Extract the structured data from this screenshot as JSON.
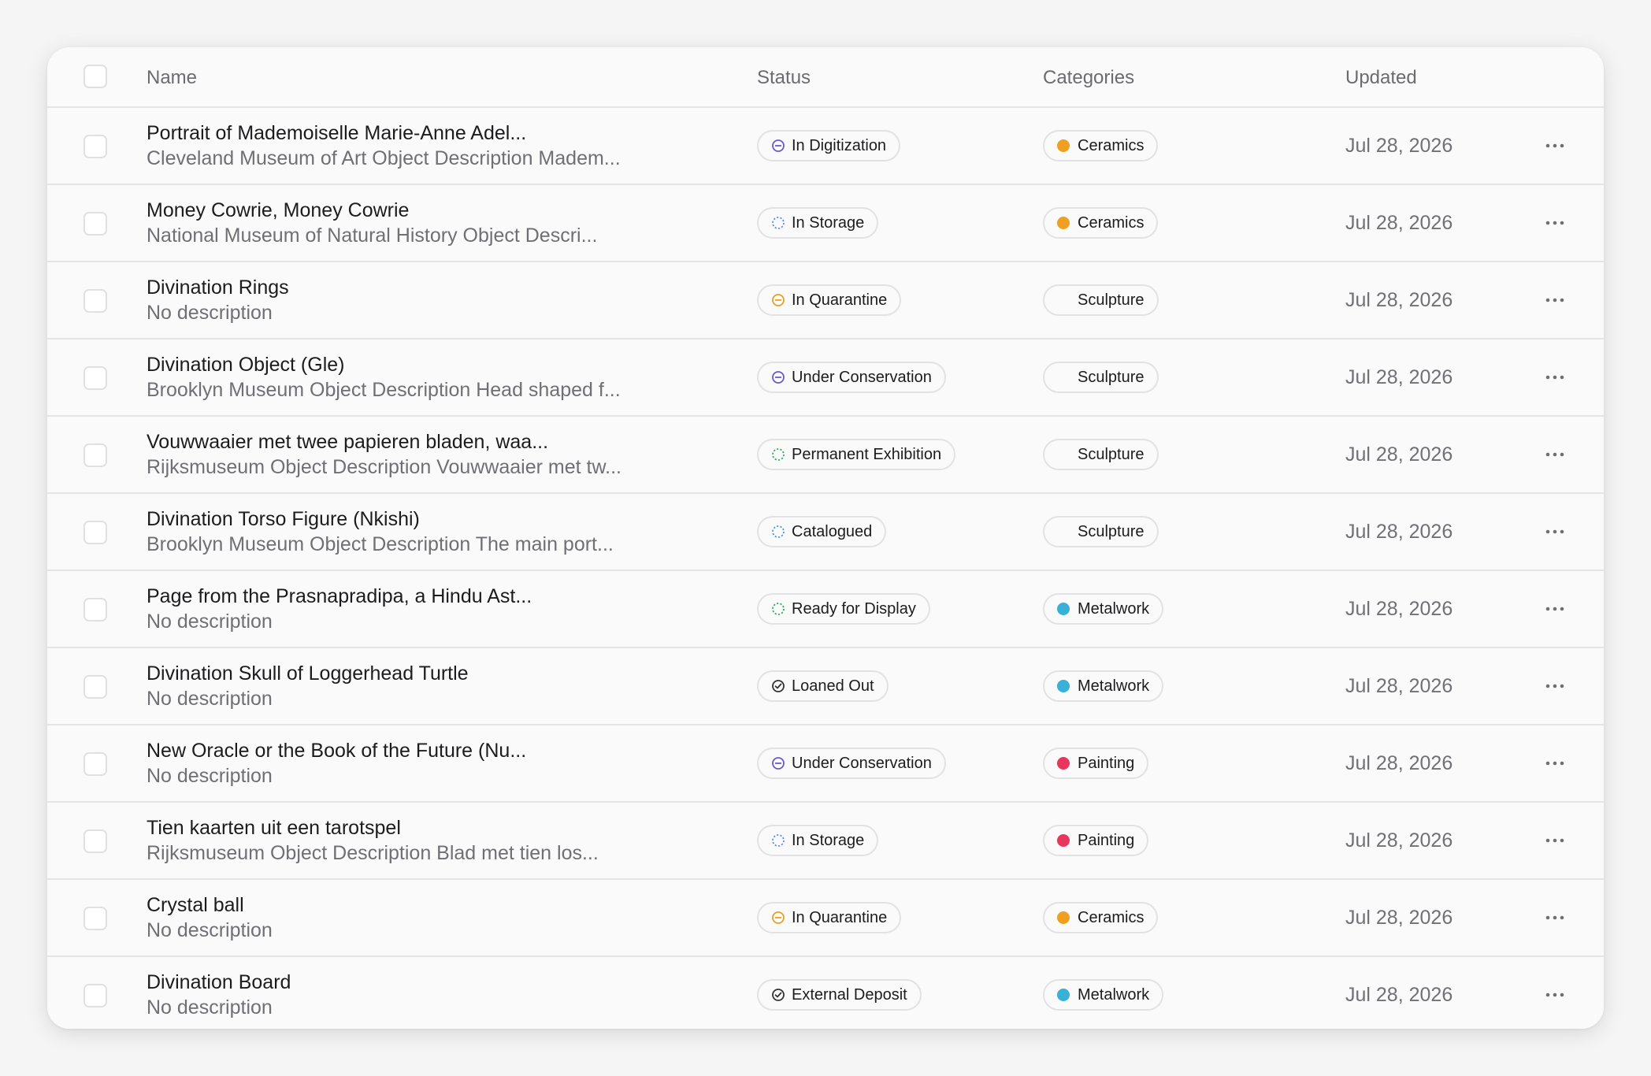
{
  "header": {
    "name": "Name",
    "status": "Status",
    "categories": "Categories",
    "updated": "Updated"
  },
  "colors": {
    "ceramics": "#f0a020",
    "metalwork": "#3ab0d8",
    "painting": "#e8365d",
    "digitization": "#6a5acd",
    "quarantine": "#e8a020",
    "conservation": "#6a5acd",
    "storage": "#5b8def",
    "exhibition": "#2fae5a",
    "catalogued": "#4a9bd8",
    "display": "#2fae5a",
    "loaned": "#333333"
  },
  "rows": [
    {
      "title": "Portrait of Mademoiselle Marie-Anne Adel...",
      "desc": "Cleveland Museum of Art Object Description Madem...",
      "status": "In Digitization",
      "status_icon": "minus-circle-icon",
      "category": "Ceramics",
      "category_icon": "dot-icon",
      "date": "Jul 28, 2026"
    },
    {
      "title": "Money Cowrie, Money Cowrie",
      "desc": "National Museum of Natural History Object Descri...",
      "status": "In Storage",
      "status_icon": "dashed-circle-icon",
      "category": "Ceramics",
      "category_icon": "dot-icon",
      "date": "Jul 28, 2026"
    },
    {
      "title": "Divination Rings",
      "desc": "No description",
      "status": "In Quarantine",
      "status_icon": "minus-circle-icon",
      "category": "Sculpture",
      "category_icon": "none",
      "date": "Jul 28, 2026"
    },
    {
      "title": "Divination Object (Gle)",
      "desc": "Brooklyn Museum Object Description Head shaped f...",
      "status": "Under Conservation",
      "status_icon": "minus-circle-icon",
      "category": "Sculpture",
      "category_icon": "none",
      "date": "Jul 28, 2026"
    },
    {
      "title": "Vouwwaaier met twee papieren bladen, waa...",
      "desc": "Rijksmuseum Object Description Vouwwaaier met tw...",
      "status": "Permanent Exhibition",
      "status_icon": "dashed-circle-icon",
      "category": "Sculpture",
      "category_icon": "none",
      "date": "Jul 28, 2026"
    },
    {
      "title": "Divination Torso Figure (Nkishi)",
      "desc": "Brooklyn Museum Object Description The main port...",
      "status": "Catalogued",
      "status_icon": "dashed-circle-icon",
      "category": "Sculpture",
      "category_icon": "none",
      "date": "Jul 28, 2026"
    },
    {
      "title": "Page from the Prasnapradipa, a Hindu Ast...",
      "desc": "No description",
      "status": "Ready for Display",
      "status_icon": "dashed-circle-icon",
      "category": "Metalwork",
      "category_icon": "dot-icon",
      "date": "Jul 28, 2026"
    },
    {
      "title": "Divination Skull of Loggerhead Turtle",
      "desc": "No description",
      "status": "Loaned Out",
      "status_icon": "check-circle-icon",
      "category": "Metalwork",
      "category_icon": "dot-icon",
      "date": "Jul 28, 2026"
    },
    {
      "title": "New Oracle or the Book of the Future (Nu...",
      "desc": "No description",
      "status": "Under Conservation",
      "status_icon": "minus-circle-icon",
      "category": "Painting",
      "category_icon": "dot-icon",
      "date": "Jul 28, 2026"
    },
    {
      "title": "Tien kaarten uit een tarotspel",
      "desc": "Rijksmuseum Object Description Blad met tien los...",
      "status": "In Storage",
      "status_icon": "dashed-circle-icon",
      "category": "Painting",
      "category_icon": "dot-icon",
      "date": "Jul 28, 2026"
    },
    {
      "title": "Crystal ball",
      "desc": "No description",
      "status": "In Quarantine",
      "status_icon": "minus-circle-icon",
      "category": "Ceramics",
      "category_icon": "dot-icon",
      "date": "Jul 28, 2026"
    },
    {
      "title": "Divination Board",
      "desc": "No description",
      "status": "External Deposit",
      "status_icon": "check-circle-icon",
      "category": "Metalwork",
      "category_icon": "dot-icon",
      "date": "Jul 28, 2026"
    }
  ]
}
